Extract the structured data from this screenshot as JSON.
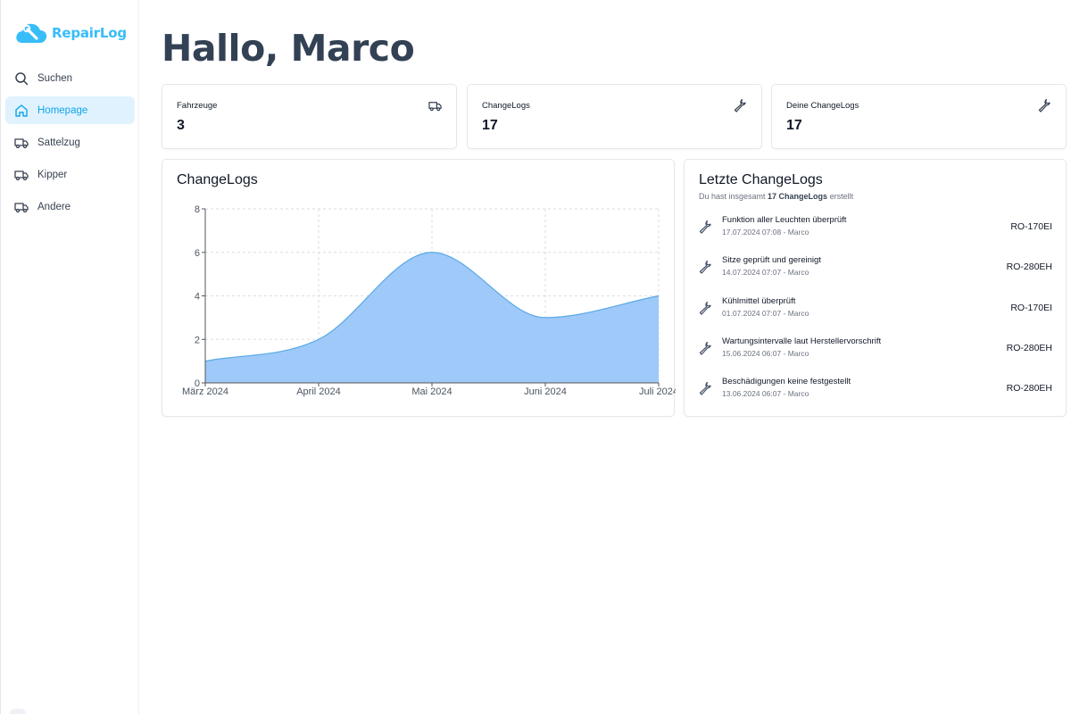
{
  "brand": {
    "name": "RepairLog",
    "color": "#38bdf8"
  },
  "nav": [
    {
      "label": "Suchen",
      "icon": "search-icon",
      "active": false
    },
    {
      "label": "Homepage",
      "icon": "home-icon",
      "active": true
    },
    {
      "label": "Sattelzug",
      "icon": "truck-icon",
      "active": false
    },
    {
      "label": "Kipper",
      "icon": "truck-icon",
      "active": false
    },
    {
      "label": "Andere",
      "icon": "truck-icon",
      "active": false
    }
  ],
  "greeting": "Hallo, Marco",
  "stats": [
    {
      "label": "Fahrzeuge",
      "value": "3",
      "icon": "truck-icon"
    },
    {
      "label": "ChangeLogs",
      "value": "17",
      "icon": "wrench-icon"
    },
    {
      "label": "Deine ChangeLogs",
      "value": "17",
      "icon": "wrench-icon"
    }
  ],
  "chart_card": {
    "title": "ChangeLogs"
  },
  "chart_data": {
    "type": "area",
    "x": [
      "März 2024",
      "April 2024",
      "Mai 2024",
      "Juni 2024",
      "Juli 2024"
    ],
    "values": [
      1,
      2,
      6,
      3,
      4
    ],
    "ylim": [
      0,
      8
    ],
    "yticks": [
      "0",
      "2",
      "4",
      "6",
      "8"
    ],
    "grid": true,
    "fill_color": "#9ec9f8",
    "line_color": "#5aa9e6"
  },
  "recent": {
    "title": "Letzte ChangeLogs",
    "subtitle_pre": "Du hast insgesamt ",
    "subtitle_bold": "17 ChangeLogs",
    "subtitle_post": " erstellt",
    "items": [
      {
        "title": "Funktion aller Leuchten überprüft",
        "meta": "17.07.2024 07:08 - Marco",
        "plate": "RO-170EI"
      },
      {
        "title": "Sitze geprüft und gereinigt",
        "meta": "14.07.2024 07:07 - Marco",
        "plate": "RO-280EH"
      },
      {
        "title": "Kühlmittel überprüft",
        "meta": "01.07.2024 07:07 - Marco",
        "plate": "RO-170EI"
      },
      {
        "title": "Wartungsintervalle laut Herstellervorschrift",
        "meta": "15.06.2024 06:07 - Marco",
        "plate": "RO-280EH"
      },
      {
        "title": "Beschädigungen keine festgestellt",
        "meta": "13.06.2024 06:07 - Marco",
        "plate": "RO-280EH"
      }
    ]
  }
}
